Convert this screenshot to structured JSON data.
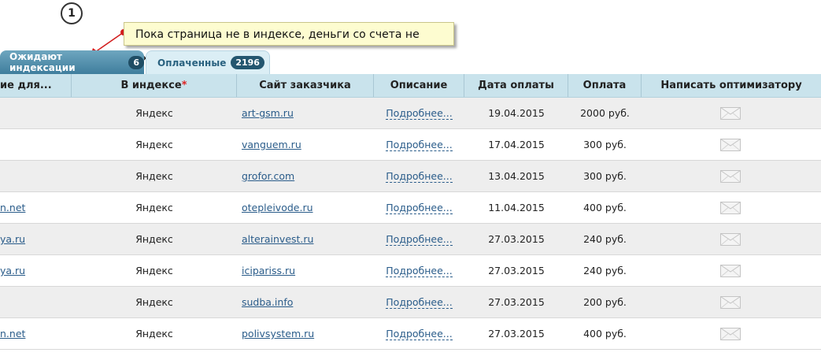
{
  "annotation": {
    "step_number": "1",
    "callout_text": "Пока страница не в индексе, деньги со счета не уходят"
  },
  "tabs": [
    {
      "label": "Ожидают индексации",
      "count": "6",
      "active": false
    },
    {
      "label": "Оплаченные",
      "count": "2196",
      "active": true
    }
  ],
  "table": {
    "headers": [
      "ие для...",
      "В индексе",
      "Сайт заказчика",
      "Описание",
      "Дата оплаты",
      "Оплата",
      "Написать оптимизатору"
    ],
    "required_mark": "*",
    "rows": [
      {
        "page": "",
        "index": "Яндекс",
        "site": "art-gsm.ru",
        "desc": "Подробнее...",
        "date": "19.04.2015",
        "pay": "2000 руб."
      },
      {
        "page": "",
        "index": "Яндекс",
        "site": "vanguem.ru",
        "desc": "Подробнее...",
        "date": "17.04.2015",
        "pay": "300 руб."
      },
      {
        "page": "",
        "index": "Яндекс",
        "site": "grofor.com",
        "desc": "Подробнее...",
        "date": "13.04.2015",
        "pay": "300 руб."
      },
      {
        "page": "n.net",
        "index": "Яндекс",
        "site": "otepleivode.ru",
        "desc": "Подробнее...",
        "date": "11.04.2015",
        "pay": "400 руб."
      },
      {
        "page": "ya.ru",
        "index": "Яндекс",
        "site": "alterainvest.ru",
        "desc": "Подробнее...",
        "date": "27.03.2015",
        "pay": "240 руб."
      },
      {
        "page": "ya.ru",
        "index": "Яндекс",
        "site": "icipariss.ru",
        "desc": "Подробнее...",
        "date": "27.03.2015",
        "pay": "240 руб."
      },
      {
        "page": "",
        "index": "Яндекс",
        "site": "sudba.info",
        "desc": "Подробнее...",
        "date": "27.03.2015",
        "pay": "200 руб."
      },
      {
        "page": "n.net",
        "index": "Яндекс",
        "site": "polivsystem.ru",
        "desc": "Подробнее...",
        "date": "27.03.2015",
        "pay": "400 руб."
      }
    ]
  },
  "icons": {
    "message": "envelope-icon"
  },
  "colors": {
    "tab_active": "#dbeef5",
    "tab_inactive": "#3f7e9d",
    "header_bg": "#c9e3ec",
    "link": "#2a5c8a",
    "required": "#dd2222"
  }
}
